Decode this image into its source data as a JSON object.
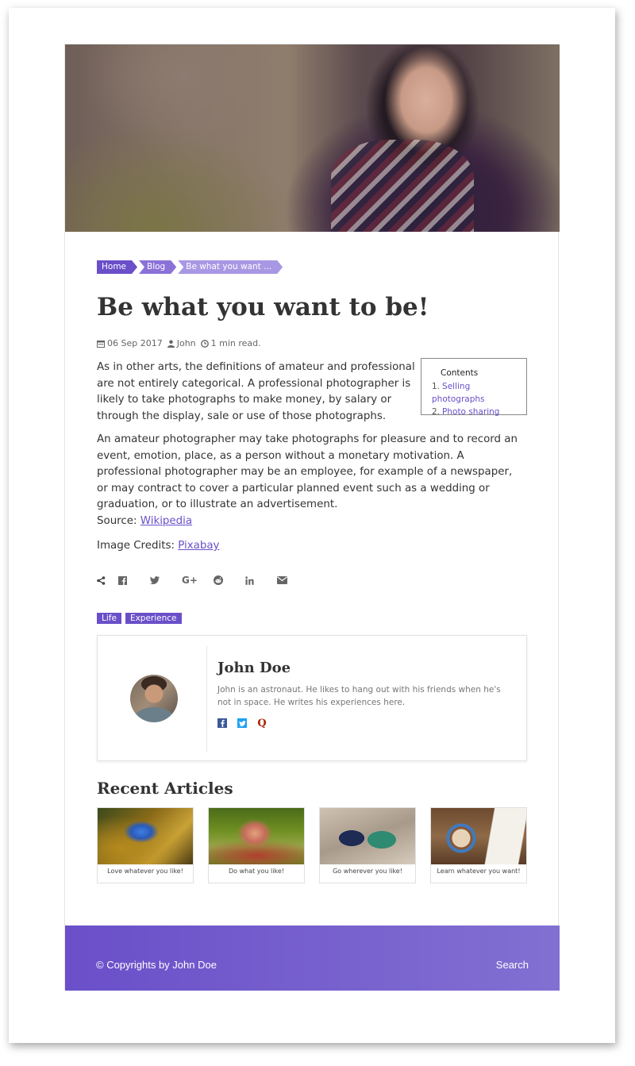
{
  "breadcrumb": [
    "Home",
    "Blog",
    "Be what you want ..."
  ],
  "post": {
    "title": "Be what you want to be!",
    "date": "06 Sep 2017",
    "author": "John",
    "read_time": "1 min read.",
    "paragraph1": "As in other arts, the definitions of amateur and professional are not entirely categorical. A professional photographer is likely to take photographs to make money, by salary or through the display, sale or use of those photographs.",
    "paragraph2": "An amateur photographer may take photographs for pleasure and to record an event, emotion, place, as a person without a monetary motivation. A professional photographer may be an employee, for example of a newspaper, or may contract to cover a particular planned event such as a wedding or graduation, or to illustrate an advertisement.",
    "source_label": "Source:",
    "source_link": "Wikipedia",
    "credits_label": "Image Credits:",
    "credits_link": "Pixabay"
  },
  "toc": {
    "heading": "Contents",
    "items": [
      {
        "num": "1.",
        "label": "Selling photographs"
      },
      {
        "num": "2.",
        "label": "Photo sharing"
      }
    ]
  },
  "share_icons": [
    "share-icon",
    "facebook-icon",
    "twitter-icon",
    "google-plus-icon",
    "reddit-icon",
    "linkedin-icon",
    "email-icon"
  ],
  "tags": [
    "Life",
    "Experience"
  ],
  "author_box": {
    "name": "John Doe",
    "bio": "John is an astronaut. He likes to hang out with his friends when he's not in space. He writes his experiences here.",
    "social_icons": [
      "facebook-icon",
      "twitter-icon",
      "quora-icon"
    ]
  },
  "recent": {
    "heading": "Recent Articles",
    "articles": [
      {
        "caption": "Love whatever you like!"
      },
      {
        "caption": "Do what you like!"
      },
      {
        "caption": "Go wherever you like!"
      },
      {
        "caption": "Learn whatever you want!"
      }
    ]
  },
  "footer": {
    "copyright": "© Copyrights by John Doe",
    "search": "Search"
  },
  "colors": {
    "accent": "#6a4fc9"
  }
}
